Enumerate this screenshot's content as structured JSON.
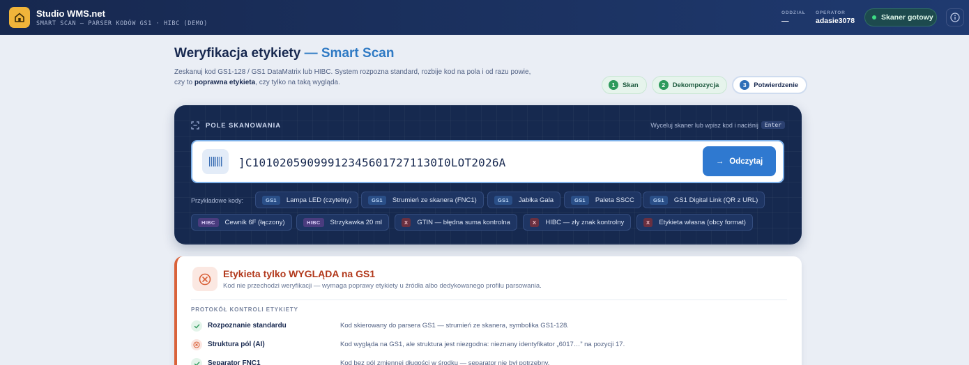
{
  "app": {
    "title": "Studio WMS.net",
    "subtitle": "SMART SCAN — PARSER KODÓW GS1 · HIBC (DEMO)"
  },
  "header": {
    "department_label": "ODDZIAŁ",
    "department_value": "—",
    "operator_label": "OPERATOR",
    "operator_value": "adasie3078",
    "scanner_status": "Skaner gotowy",
    "status_color": "#3ddc84"
  },
  "page": {
    "title": "Weryfikacja etykiety",
    "title_accent": "— Smart Scan",
    "lead_1": "Zeskanuj kod GS1-128 / GS1 DataMatrix lub HIBC. System rozpozna standard, rozbije kod na pola i od razu powie, czy to ",
    "lead_bold": "poprawna etykieta",
    "lead_2": ", czy tylko na taką wygląda."
  },
  "steps": [
    {
      "num": "1",
      "label": "Skan"
    },
    {
      "num": "2",
      "label": "Dekompozycja"
    },
    {
      "num": "3",
      "label": "Potwierdzenie"
    }
  ],
  "scan": {
    "heading": "POLE SKANOWANIA",
    "hint": "Wyceluj skaner lub wpisz kod i naciśnij",
    "hint_key": "Enter",
    "value": "]C101020590999123456017271130I0LOT2026A",
    "read_button": "Odczytaj",
    "examples_label": "Przykładowe kody:"
  },
  "examples": [
    {
      "tag": "GS1",
      "label": "Lampa LED (czytelny)"
    },
    {
      "tag": "GS1",
      "label": "Strumień ze skanera (FNC1)"
    },
    {
      "tag": "GS1",
      "label": "Jabłka Gala"
    },
    {
      "tag": "GS1",
      "label": "Paleta SSCC"
    },
    {
      "tag": "GS1",
      "label": "GS1 Digital Link (QR z URL)"
    },
    {
      "tag": "HIBC",
      "label": "Cewnik 6F (łączony)"
    },
    {
      "tag": "HIBC",
      "label": "Strzykawka 20 ml"
    },
    {
      "tag": "X",
      "label": "GTIN — błędna suma kontrolna"
    },
    {
      "tag": "X",
      "label": "HIBC — zły znak kontrolny"
    },
    {
      "tag": "X",
      "label": "Etykieta własna (obcy format)"
    }
  ],
  "result": {
    "title": "Etykieta tylko WYGLĄDA na GS1",
    "subtitle": "Kod nie przechodzi weryfikacji — wymaga poprawy etykiety u źródła albo dedykowanego profilu parsowania.",
    "protocol_label": "PROTOKÓŁ KONTROLI ETYKIETY",
    "accent_color": "#d9623a",
    "checks": [
      {
        "status": "ok",
        "name": "Rozpoznanie standardu",
        "desc": "Kod skierowany do parsera GS1 — strumień ze skanera, symbolika GS1-128."
      },
      {
        "status": "err",
        "name": "Struktura pól (AI)",
        "desc": "Kod wygląda na GS1, ale struktura jest niezgodna: nieznany identyfikator „6017…” na pozycji 17."
      },
      {
        "status": "ok",
        "name": "Separator FNC1",
        "desc": "Kod bez pól zmiennej długości w środku — separator nie był potrzebny."
      }
    ]
  }
}
